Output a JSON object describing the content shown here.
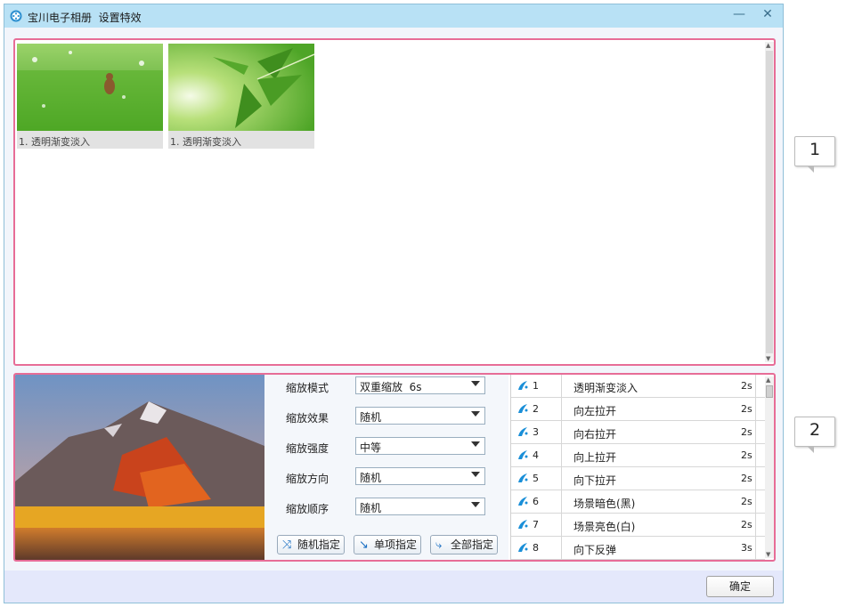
{
  "window": {
    "title": "宝川电子相册  设置特效",
    "minimize": "—",
    "close": "✕"
  },
  "thumbnails": [
    {
      "label": "1. 透明渐变淡入",
      "icon": "meadow-squirrel-photo"
    },
    {
      "label": "1. 透明渐变淡入",
      "icon": "green-leaf-photo"
    }
  ],
  "preview": {
    "icon": "mountain-lake-photo"
  },
  "settings": [
    {
      "label": "缩放模式",
      "value": "双重缩放  6s"
    },
    {
      "label": "缩放效果",
      "value": "随机"
    },
    {
      "label": "缩放强度",
      "value": "中等"
    },
    {
      "label": "缩放方向",
      "value": "随机"
    },
    {
      "label": "缩放顺序",
      "value": "随机"
    }
  ],
  "actions": {
    "random": "随机指定",
    "single": "单项指定",
    "all": "全部指定"
  },
  "effects": [
    {
      "num": "1",
      "name": "透明渐变淡入",
      "dur": "2s"
    },
    {
      "num": "2",
      "name": "向左拉开",
      "dur": "2s"
    },
    {
      "num": "3",
      "name": "向右拉开",
      "dur": "2s"
    },
    {
      "num": "4",
      "name": "向上拉开",
      "dur": "2s"
    },
    {
      "num": "5",
      "name": "向下拉开",
      "dur": "2s"
    },
    {
      "num": "6",
      "name": "场景暗色(黑)",
      "dur": "2s"
    },
    {
      "num": "7",
      "name": "场景亮色(白)",
      "dur": "2s"
    },
    {
      "num": "8",
      "name": "向下反弹",
      "dur": "3s"
    }
  ],
  "footer": {
    "ok": "确定"
  },
  "callouts": [
    "1",
    "2"
  ],
  "colors": {
    "highlight": "#e76d97",
    "titlebar": "#b8e1f5",
    "accent": "#1a6fc2"
  }
}
